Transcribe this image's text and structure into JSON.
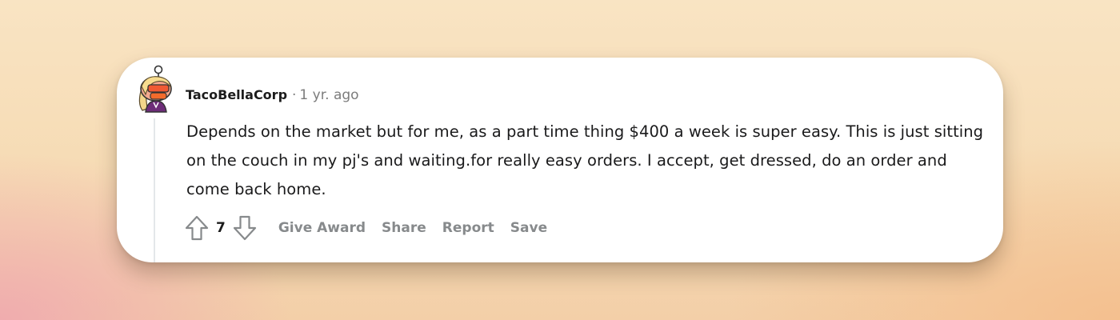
{
  "comment": {
    "username": "TacoBellaCorp",
    "separator": "·",
    "time": "1 yr. ago",
    "body": "Depends on the market but for me, as a part time thing $400 a week is super easy. This is just sitting on the couch in my pj's and waiting.for really easy orders. I accept, get dressed, do an order and come back home.",
    "votes": "7"
  },
  "actions": {
    "give_award": "Give Award",
    "share": "Share",
    "report": "Report",
    "save": "Save"
  },
  "icons": {
    "avatar": "avatar-icon",
    "upvote": "upvote-arrow-icon",
    "downvote": "downvote-arrow-icon"
  },
  "colors": {
    "card_background": "#ffffff",
    "text": "#1a1a1b",
    "meta_text": "#7c7c7c",
    "action_text": "#878a8c",
    "thread_line": "#e4e7ea"
  }
}
